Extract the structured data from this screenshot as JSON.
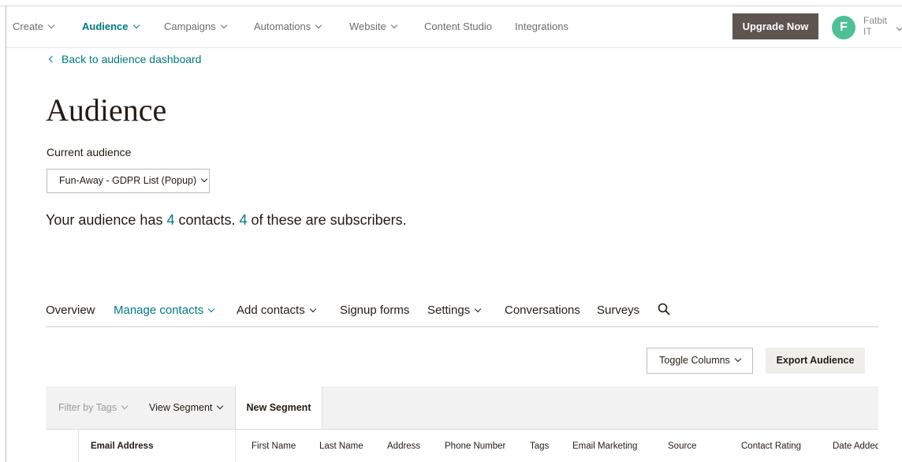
{
  "topnav": {
    "items": [
      {
        "label": "Create"
      },
      {
        "label": "Audience"
      },
      {
        "label": "Campaigns"
      },
      {
        "label": "Automations"
      },
      {
        "label": "Website"
      },
      {
        "label": "Content Studio"
      },
      {
        "label": "Integrations"
      }
    ],
    "upgrade_label": "Upgrade Now",
    "avatar_initial": "F",
    "user_first": "Fatbit",
    "user_last": "IT"
  },
  "colors": {
    "accent": "#00797f",
    "upgrade_button": "#5e5550",
    "avatar": "#4fbf96"
  },
  "page": {
    "back_link": "Back to audience dashboard",
    "title": "Audience",
    "current_audience_label": "Current audience",
    "audience_selected": "Fun-Away - GDPR List (Popup)",
    "summary": {
      "prefix": "Your audience has ",
      "contacts": "4",
      "middle": " contacts. ",
      "subscribers": "4",
      "suffix": " of these are subscribers."
    }
  },
  "subnav": {
    "items": [
      {
        "label": "Overview"
      },
      {
        "label": "Manage contacts"
      },
      {
        "label": "Add contacts"
      },
      {
        "label": "Signup forms"
      },
      {
        "label": "Settings"
      },
      {
        "label": "Conversations"
      },
      {
        "label": "Surveys"
      }
    ],
    "search_icon": "search-icon"
  },
  "actions": {
    "toggle_columns": "Toggle Columns",
    "export": "Export Audience"
  },
  "toolbar": {
    "filter_tags": "Filter by Tags",
    "view_segment": "View Segment",
    "new_segment": "New Segment"
  },
  "table": {
    "columns": [
      "Email Address",
      "First Name",
      "Last Name",
      "Address",
      "Phone Number",
      "Tags",
      "Email Marketing",
      "Source",
      "Contact Rating",
      "Date Added"
    ]
  }
}
